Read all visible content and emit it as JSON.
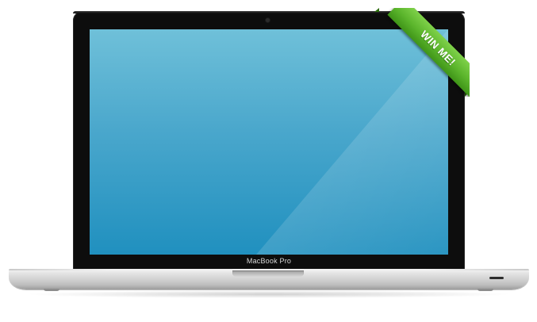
{
  "device": {
    "brand_label": "MacBook Pro",
    "screen_color_top": "#6fc0d9",
    "screen_color_bottom": "#2090bf",
    "body_color": "#0d0d0d",
    "base_color": "#d2d2d2"
  },
  "ribbon": {
    "label": "WIN ME!",
    "color": "#5bb52c"
  }
}
